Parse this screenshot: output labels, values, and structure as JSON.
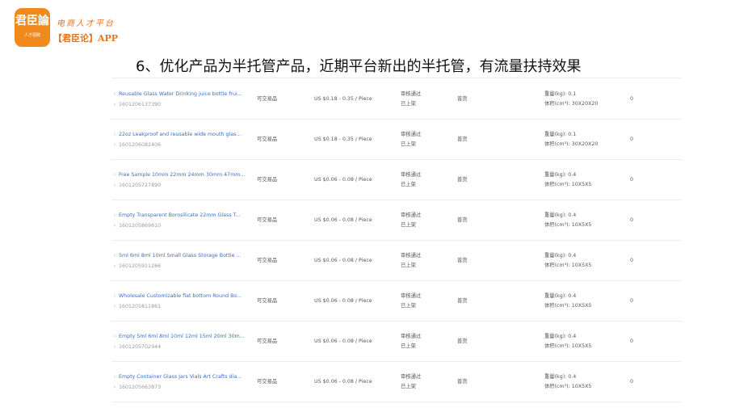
{
  "brand": {
    "logo_text": "君臣論",
    "logo_sub": "人才招聘",
    "slogan": "电商人才平台",
    "app_name": "【君臣论】APP"
  },
  "headline": "6、优化产品为半托管产品，近期平台新出的半托管，有流量扶持效果",
  "rows": [
    {
      "title": "Reusable Glass Water Drinking juice bottle frui...",
      "id": "1601206137390",
      "trade": "可交易品",
      "price": "US $0.18 - 0.35 / Piece",
      "audit": "审核通过",
      "shelf": "已上架",
      "type": "普货",
      "weight": "重量(kg): 0.1",
      "volume": "体积(cm³): 30X20X20",
      "stock": "0"
    },
    {
      "title": "22oz Leakproof and reusable wide mouth glas...",
      "id": "1601206082406",
      "trade": "可交易品",
      "price": "US $0.18 - 0.35 / Piece",
      "audit": "审核通过",
      "shelf": "已上架",
      "type": "普货",
      "weight": "重量(kg): 0.1",
      "volume": "体积(cm³): 30X20X20",
      "stock": "0"
    },
    {
      "title": "Free Sample 10mm 22mm 24mm 30mm 47mm...",
      "id": "1601205727890",
      "trade": "可交易品",
      "price": "US $0.06 - 0.08 / Piece",
      "audit": "审核通过",
      "shelf": "已上架",
      "type": "普货",
      "weight": "重量(kg): 0.4",
      "volume": "体积(cm³): 10X5X5",
      "stock": "0"
    },
    {
      "title": "Empty Transparent Borosilicate 22mm Glass T...",
      "id": "1601205869610",
      "trade": "可交易品",
      "price": "US $0.06 - 0.08 / Piece",
      "audit": "审核通过",
      "shelf": "已上架",
      "type": "普货",
      "weight": "重量(kg): 0.4",
      "volume": "体积(cm³): 10X5X5",
      "stock": "0"
    },
    {
      "title": "5ml 6ml 8ml 10ml Small Glass Storage Bottle ...",
      "id": "1601205911266",
      "trade": "可交易品",
      "price": "US $0.06 - 0.08 / Piece",
      "audit": "审核通过",
      "shelf": "已上架",
      "type": "普货",
      "weight": "重量(kg): 0.4",
      "volume": "体积(cm³): 10X5X5",
      "stock": "0"
    },
    {
      "title": "Wholesale Customizable flat bottom Round Bo...",
      "id": "1601205811861",
      "trade": "可交易品",
      "price": "US $0.06 - 0.08 / Piece",
      "audit": "审核通过",
      "shelf": "已上架",
      "type": "普货",
      "weight": "重量(kg): 0.4",
      "volume": "体积(cm³): 10X5X5",
      "stock": "0"
    },
    {
      "title": "Empty 5ml 6ml 8ml 10ml 12ml 15ml 20ml 30m...",
      "id": "1601205702944",
      "trade": "可交易品",
      "price": "US $0.06 - 0.08 / Piece",
      "audit": "审核通过",
      "shelf": "已上架",
      "type": "普货",
      "weight": "重量(kg): 0.4",
      "volume": "体积(cm³): 10X5X5",
      "stock": "0"
    },
    {
      "title": "Empty Container Glass Jars Vials Art Crafts dia...",
      "id": "1601205663873",
      "trade": "可交易品",
      "price": "US $0.06 - 0.08 / Piece",
      "audit": "审核通过",
      "shelf": "已上架",
      "type": "普货",
      "weight": "重量(kg): 0.4",
      "volume": "体积(cm³): 10X5X5",
      "stock": "0"
    }
  ]
}
